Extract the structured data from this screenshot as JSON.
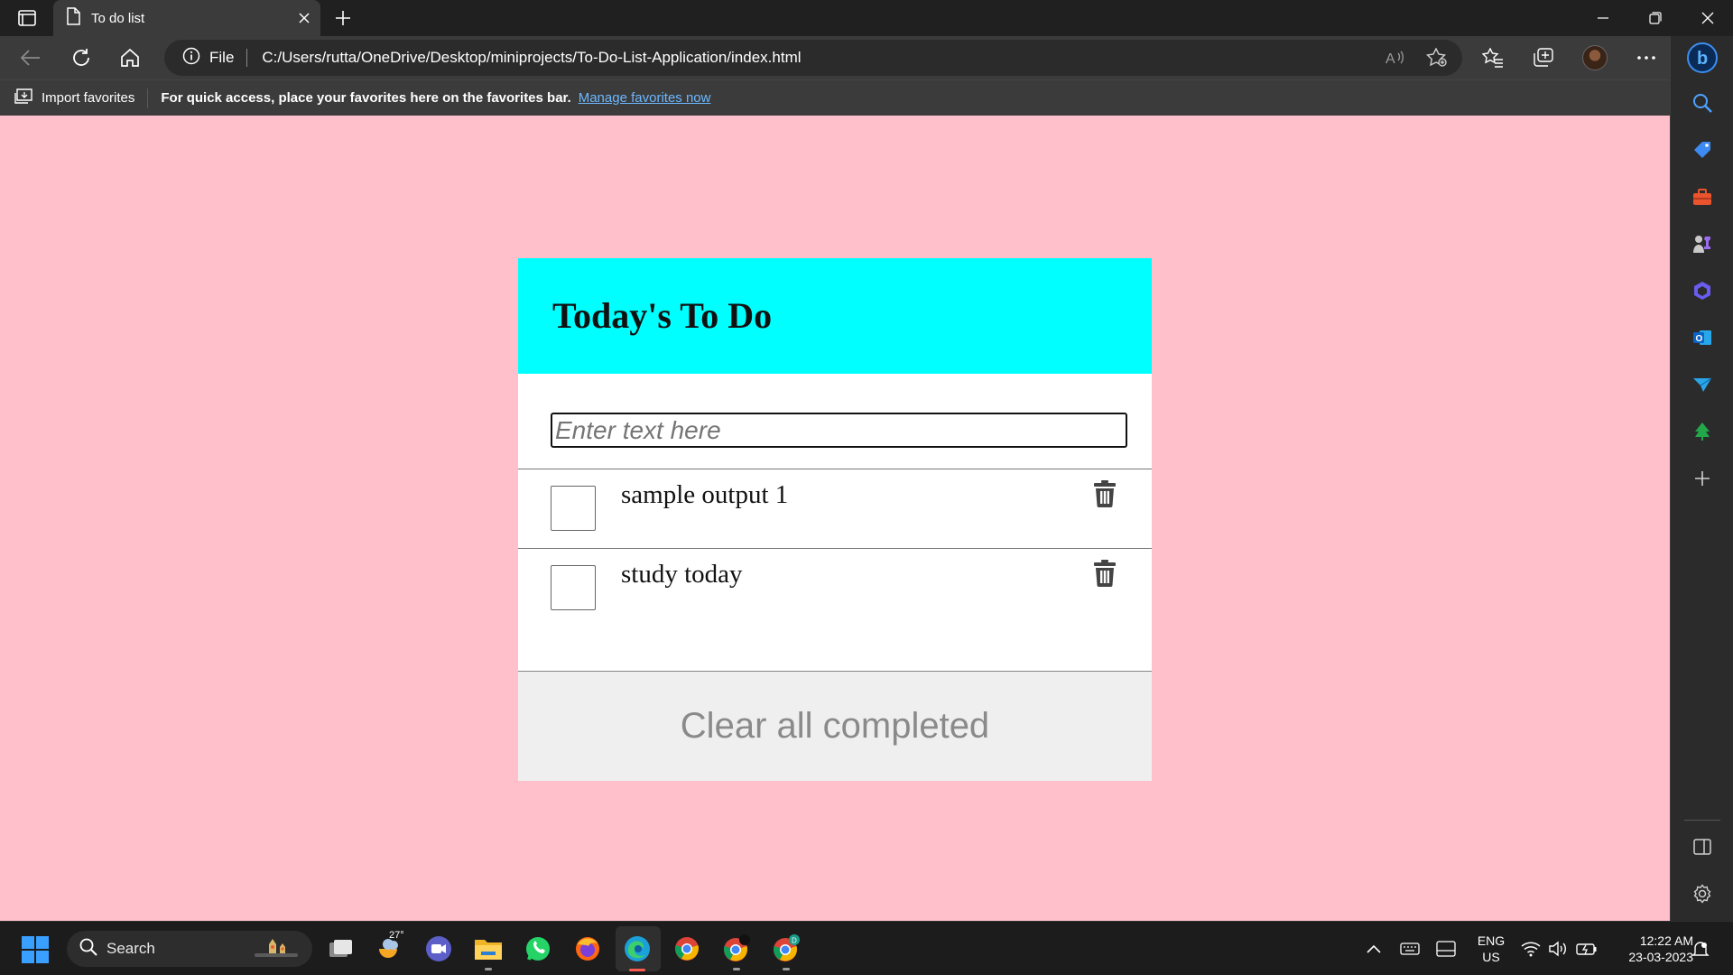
{
  "browser": {
    "tab_title": "To do list",
    "address_prefix": "File",
    "address_url": "C:/Users/rutta/OneDrive/Desktop/miniprojects/To-Do-List-Application/index.html",
    "favorites_bar": {
      "import_label": "Import favorites",
      "message": "For quick access, place your favorites here on the favorites bar.",
      "link": "Manage favorites now"
    }
  },
  "todo": {
    "title": "Today's To Do",
    "input_placeholder": "Enter text here",
    "input_value": "",
    "items": [
      {
        "text": "sample output 1",
        "checked": false
      },
      {
        "text": "study today",
        "checked": false
      }
    ],
    "clear_button": "Clear all completed"
  },
  "colors": {
    "page_background": "#ffc0cb",
    "header_background": "#00ffff",
    "footer_background": "#efefef",
    "clear_button_text": "#8a8a8a"
  },
  "sidebar": {
    "items": [
      "search-icon",
      "shopping-tag-icon",
      "tools-icon",
      "games-icon",
      "office-icon",
      "outlook-icon",
      "send-icon",
      "tree-icon",
      "add-icon",
      "split-screen-icon",
      "settings-icon"
    ]
  },
  "taskbar": {
    "search_label": "Search",
    "weather_temp": "27°",
    "apps": [
      "task-view-icon",
      "weather-icon",
      "meet-icon",
      "file-explorer-icon",
      "whatsapp-icon",
      "firefox-icon",
      "edge-icon",
      "chrome-icon",
      "chrome-profile-icon",
      "chrome-profile-d-icon"
    ],
    "language_line1": "ENG",
    "language_line2": "US",
    "time": "12:22 AM",
    "date": "23-03-2023"
  }
}
